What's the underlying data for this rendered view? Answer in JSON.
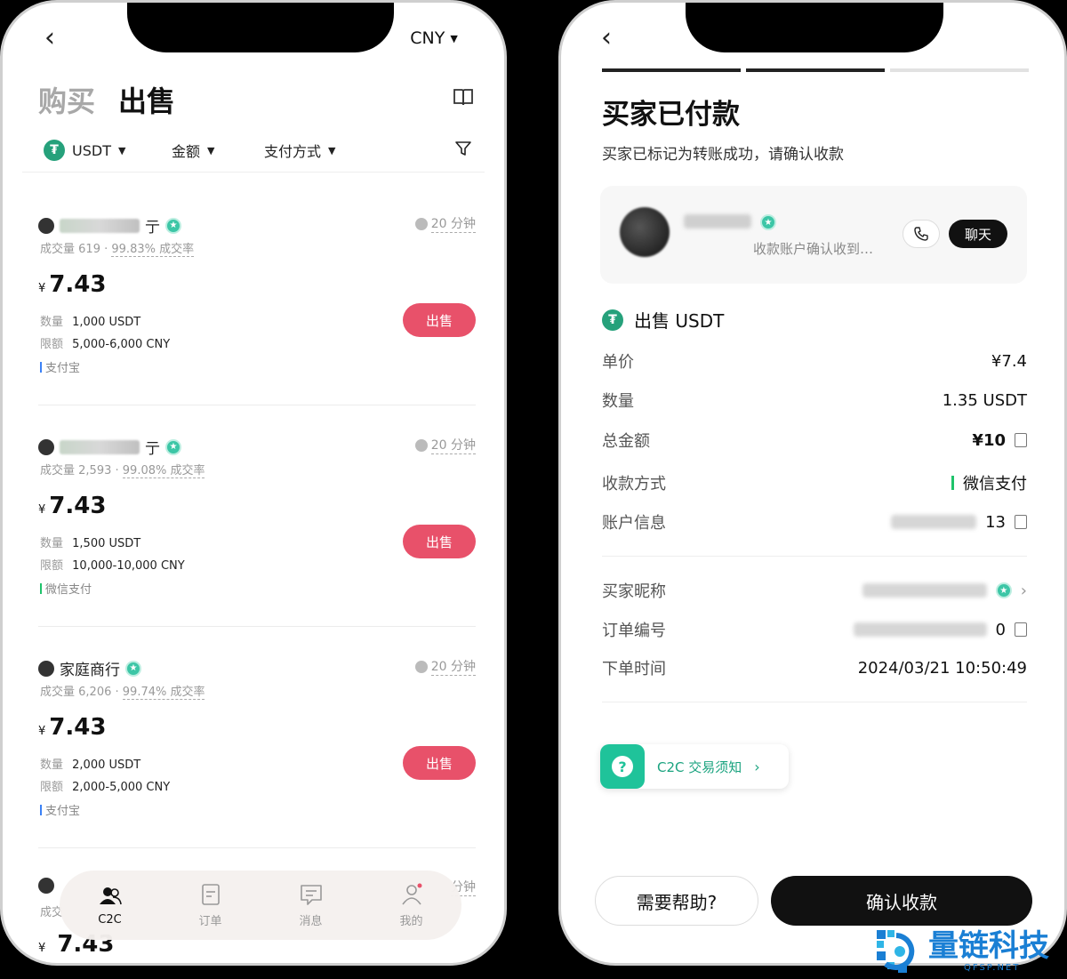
{
  "left": {
    "currency": "CNY",
    "tabs": {
      "buy": "购买",
      "sell": "出售"
    },
    "filters": {
      "coin": "USDT",
      "amount": "金额",
      "payment": "支付方式"
    },
    "listings": [
      {
        "name_tail": "亍",
        "volume_label": "成交量",
        "volume": "619",
        "rate": "99.83% 成交率",
        "time": "20 分钟",
        "yen": "¥",
        "price": "7.43",
        "qty_label": "数量",
        "qty": "1,000 USDT",
        "limit_label": "限额",
        "limit": "5,000-6,000 CNY",
        "payment": "支付宝",
        "pay_color": "#3b82f6",
        "button": "出售"
      },
      {
        "name_tail": "亍",
        "volume_label": "成交量",
        "volume": "2,593",
        "rate": "99.08% 成交率",
        "time": "20 分钟",
        "yen": "¥",
        "price": "7.43",
        "qty_label": "数量",
        "qty": "1,500 USDT",
        "limit_label": "限额",
        "limit": "10,000-10,000 CNY",
        "payment": "微信支付",
        "pay_color": "#1fc36b",
        "button": "出售"
      },
      {
        "name_tail": "家庭商行",
        "volume_label": "成交量",
        "volume": "6,206",
        "rate": "99.74% 成交率",
        "time": "20 分钟",
        "yen": "¥",
        "price": "7.43",
        "qty_label": "数量",
        "qty": "2,000 USDT",
        "limit_label": "限额",
        "limit": "2,000-5,000 CNY",
        "payment": "支付宝",
        "pay_color": "#3b82f6",
        "button": "出售"
      }
    ],
    "partial": {
      "volume_label": "成交",
      "time": "分钟",
      "yen": "¥",
      "price": "7.43"
    },
    "nav": [
      {
        "label": "C2C",
        "icon": "c2c-users-icon"
      },
      {
        "label": "订单",
        "icon": "orders-icon"
      },
      {
        "label": "消息",
        "icon": "messages-icon"
      },
      {
        "label": "我的",
        "icon": "profile-icon"
      }
    ]
  },
  "right": {
    "title": "买家已付款",
    "subtitle": "买家已标记为转账成功，请确认收款",
    "buyer_card": {
      "message": "收款账户确认收到…",
      "chat": "聊天"
    },
    "order_heading": "出售 USDT",
    "details": {
      "unit_price_label": "单价",
      "unit_price": "¥7.4",
      "quantity_label": "数量",
      "quantity": "1.35 USDT",
      "total_label": "总金额",
      "total": "¥10",
      "method_label": "收款方式",
      "method": "微信支付",
      "account_label": "账户信息",
      "account_tail": "13",
      "buyer_nick_label": "买家昵称",
      "order_no_label": "订单编号",
      "order_no_tail": "0",
      "time_label": "下单时间",
      "time": "2024/03/21 10:50:49"
    },
    "notice": "C2C 交易须知",
    "help_button": "需要帮助?",
    "confirm_button": "确认收款"
  },
  "watermark": {
    "text": "量链科技",
    "url": "QFSP.NET"
  },
  "colors": {
    "sell_button": "#e8516a",
    "tether": "#26a17b",
    "verified": "#3cc6a6",
    "wechat_green": "#1fc36b",
    "watermark_blue": "#1a7fd4"
  }
}
